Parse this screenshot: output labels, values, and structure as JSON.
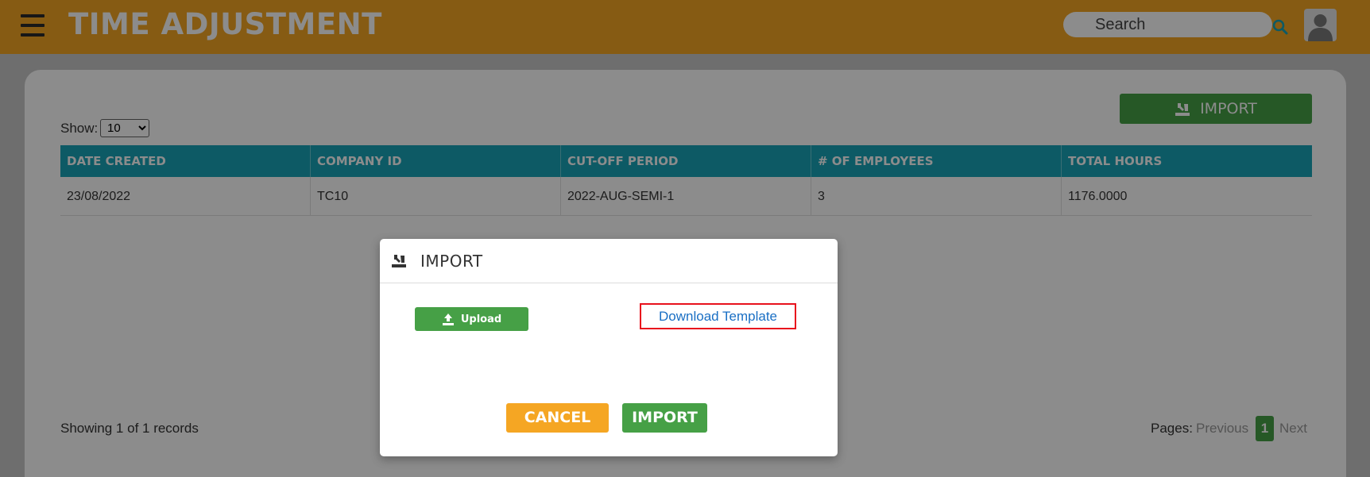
{
  "app": {
    "title": "TIME ADJUSTMENT"
  },
  "search": {
    "placeholder": "Search"
  },
  "toolbar": {
    "import_label": "IMPORT"
  },
  "show": {
    "label": "Show:",
    "selected": "10",
    "options": [
      "10"
    ]
  },
  "table": {
    "columns": [
      "DATE CREATED",
      "COMPANY ID",
      "CUT-OFF PERIOD",
      "# OF EMPLOYEES",
      "TOTAL HOURS"
    ],
    "rows": [
      [
        "23/08/2022",
        "TC10",
        "2022-AUG-SEMI-1",
        "3",
        "1176.0000"
      ]
    ]
  },
  "footer": {
    "records": "Showing 1 of 1 records",
    "pages_label": "Pages:",
    "previous": "Previous",
    "current_page": "1",
    "next": "Next"
  },
  "modal": {
    "title": "IMPORT",
    "upload_label": "Upload",
    "download_label": "Download Template",
    "cancel_label": "CANCEL",
    "import_label": "IMPORT"
  },
  "icons": {
    "menu": "hamburger-icon",
    "search": "search-icon",
    "avatar": "user-avatar-icon",
    "import": "import-icon",
    "upload": "upload-icon"
  },
  "colors": {
    "header": "#f5a623",
    "primary_green": "#46a046",
    "table_header": "#19a5b8",
    "link": "#1a6fc4",
    "highlight": "#e8101c",
    "cancel": "#f5a623"
  }
}
